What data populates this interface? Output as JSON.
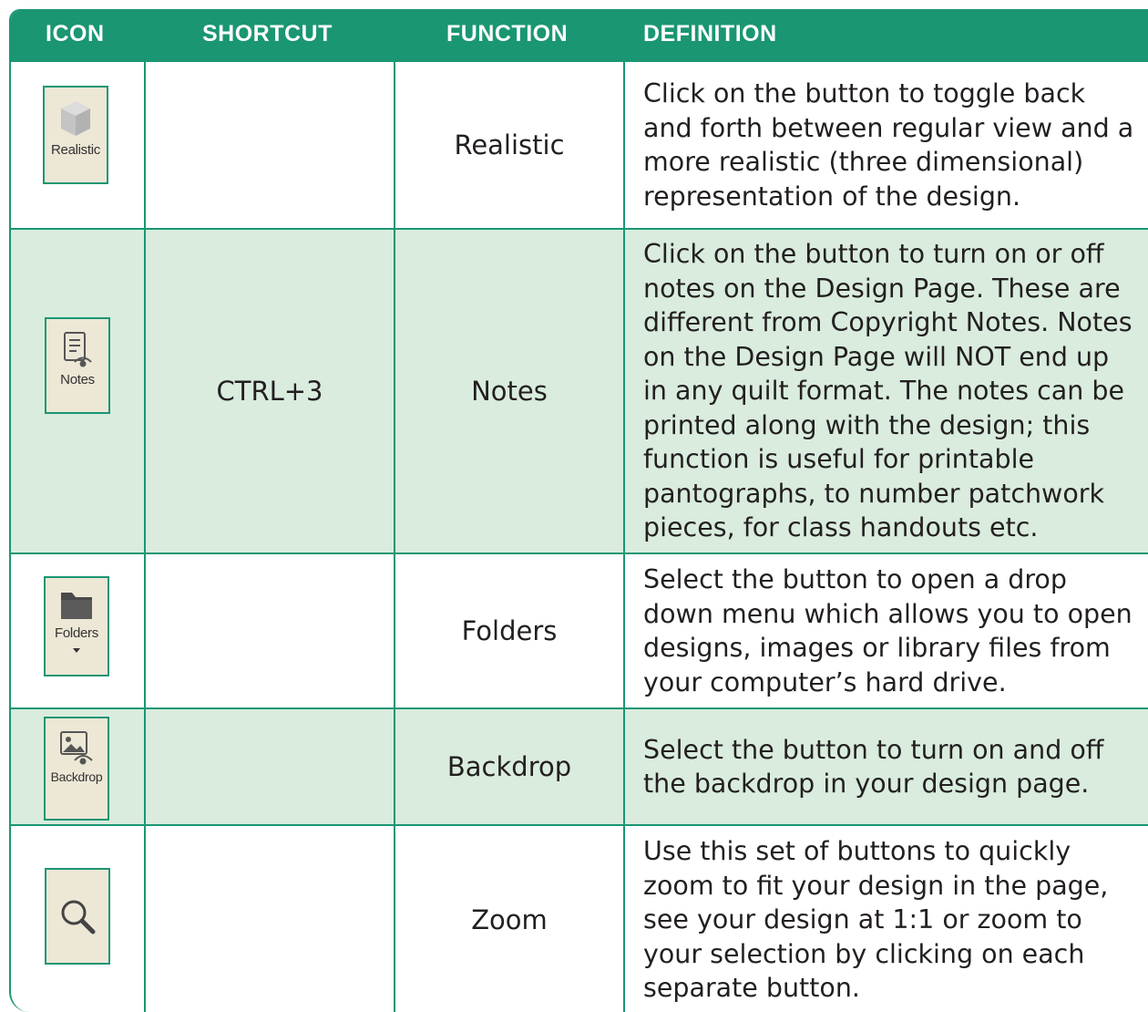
{
  "header": {
    "icon": "ICON",
    "shortcut": "SHORTCUT",
    "function": "FUNCTION",
    "definition": "DEFINITION"
  },
  "rows": [
    {
      "icon_name": "cube-icon",
      "icon_label": "Realistic",
      "shortcut": "",
      "function": "Realistic",
      "definition": "Click on the button to toggle back and forth between regular view and a more realistic (three dimensional) representation of the design."
    },
    {
      "icon_name": "notes-icon",
      "icon_label": "Notes",
      "shortcut": "CTRL+3",
      "function": "Notes",
      "definition": "Click on the button to turn on or off notes on the Design Page. These are different from Copyright Notes. Notes on the Design Page will NOT end up in any quilt format. The notes can be printed along with the design; this function is useful for printable pantographs, to number patchwork pieces, for class handouts etc."
    },
    {
      "icon_name": "folder-icon",
      "icon_label": "Folders",
      "shortcut": "",
      "function": "Folders",
      "definition": "Select the button to open a drop down menu which allows you to open designs, images or library files from your computer’s hard drive."
    },
    {
      "icon_name": "backdrop-icon",
      "icon_label": "Backdrop",
      "shortcut": "",
      "function": "Backdrop",
      "definition": "Select the button to turn on and off the backdrop in your design page."
    },
    {
      "icon_name": "magnifier-icon",
      "icon_label": "",
      "shortcut": "",
      "function": "Zoom",
      "definition": "Use this set of buttons to quickly zoom to fit your design in the page, see your design at 1:1 or zoom to your selection by clicking on each separate button."
    }
  ],
  "colors": {
    "accent": "#1a9673",
    "shade": "#d9ecde",
    "icon_bg": "#ede7d6",
    "text": "#231f20"
  }
}
